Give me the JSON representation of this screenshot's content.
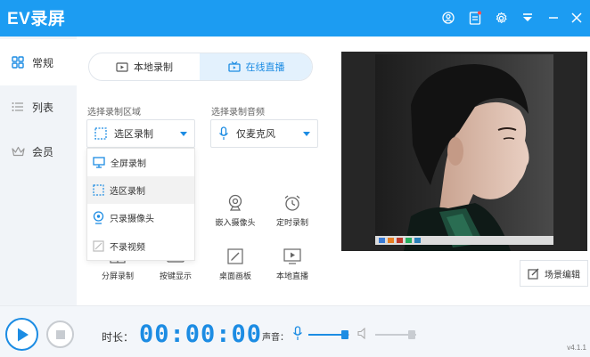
{
  "app": {
    "title": "EV录屏"
  },
  "titlebar": {
    "icons": [
      "user-icon",
      "clipboard-icon",
      "gear-icon",
      "download-icon",
      "minimize-icon",
      "close-icon"
    ]
  },
  "sidebar": {
    "items": [
      {
        "label": "常规",
        "icon": "grid-icon",
        "active": true
      },
      {
        "label": "列表",
        "icon": "list-icon",
        "active": false
      },
      {
        "label": "会员",
        "icon": "crown-icon",
        "active": false
      }
    ]
  },
  "tabs": [
    {
      "label": "本地录制",
      "icon": "film-icon",
      "active": false
    },
    {
      "label": "在线直播",
      "icon": "tv-icon",
      "active": true
    }
  ],
  "record_area": {
    "label": "选择录制区域",
    "selected": "选区录制",
    "options": [
      {
        "label": "全屏录制",
        "icon": "monitor-icon"
      },
      {
        "label": "选区录制",
        "icon": "dashed-rect-icon"
      },
      {
        "label": "只录摄像头",
        "icon": "webcam-icon"
      },
      {
        "label": "不录视频",
        "icon": "no-video-icon"
      }
    ]
  },
  "audio": {
    "label": "选择录制音频",
    "selected": "仅麦克风"
  },
  "tools": [
    {
      "label": "嵌入摄像头",
      "icon": "webcam-icon"
    },
    {
      "label": "定时录制",
      "icon": "alarm-icon"
    },
    {
      "label": "分屏录制",
      "icon": "split-icon"
    },
    {
      "label": "按键显示",
      "icon": "keyboard-icon"
    },
    {
      "label": "桌面画板",
      "icon": "pen-icon"
    },
    {
      "label": "本地直播",
      "icon": "play-screen-icon"
    }
  ],
  "scene_edit": {
    "label": "场景编辑"
  },
  "bottom": {
    "duration_label": "时长：",
    "timer": "00:00:00",
    "volume_label": "声音：",
    "mic_level": 0.9,
    "speaker_level": 0.9,
    "version": "v4.1.1"
  },
  "colors": {
    "accent": "#1c9cf2",
    "sidebar_bg": "#f1f4f8",
    "active_tab_bg": "#e3f1fd"
  }
}
